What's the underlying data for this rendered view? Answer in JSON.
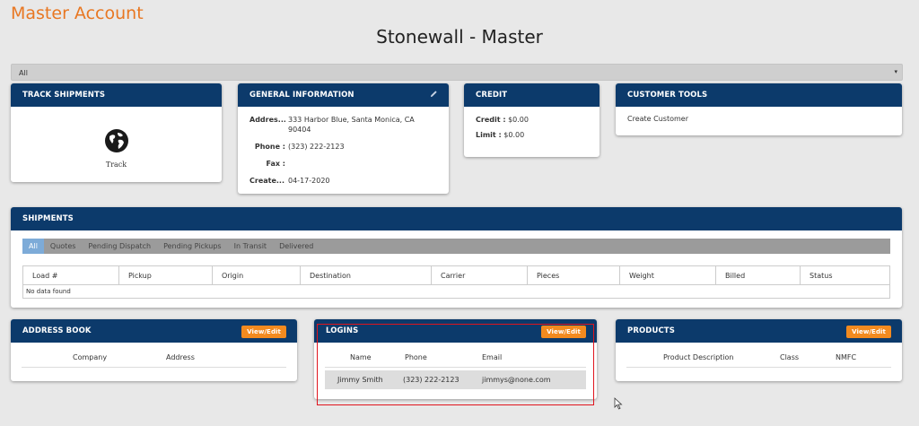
{
  "page": {
    "title": "Master Account",
    "account_name": "Stonewall - Master"
  },
  "filter": {
    "value": "All",
    "caret": "▾"
  },
  "track": {
    "header": "TRACK SHIPMENTS",
    "label": "Track"
  },
  "general": {
    "header": "GENERAL INFORMATION",
    "address_label": "Addres...",
    "address_value": "333 Harbor Blue, Santa Monica, CA 90404",
    "phone_label": "Phone :",
    "phone_value": "(323) 222-2123",
    "fax_label": "Fax :",
    "fax_value": "",
    "created_label": "Create...",
    "created_value": "04-17-2020"
  },
  "credit": {
    "header": "CREDIT",
    "credit_label": "Credit :",
    "credit_value": "$0.00",
    "limit_label": "Limit :",
    "limit_value": "$0.00"
  },
  "tools": {
    "header": "CUSTOMER TOOLS",
    "create_customer": "Create Customer"
  },
  "shipments": {
    "header": "SHIPMENTS",
    "tabs": [
      "All",
      "Quotes",
      "Pending Dispatch",
      "Pending Pickups",
      "In Transit",
      "Delivered"
    ],
    "columns": [
      "Load #",
      "Pickup",
      "Origin",
      "Destination",
      "Carrier",
      "Pieces",
      "Weight",
      "Billed",
      "Status"
    ],
    "empty": "No data found"
  },
  "address_book": {
    "header": "ADDRESS BOOK",
    "button": "View/Edit",
    "columns": [
      "Company",
      "Address"
    ]
  },
  "logins": {
    "header": "LOGINS",
    "button": "View/Edit",
    "columns": [
      "Name",
      "Phone",
      "Email"
    ],
    "rows": [
      {
        "name": "Jimmy Smith",
        "phone": "(323) 222-2123",
        "email": "jimmys@none.com"
      }
    ]
  },
  "products": {
    "header": "PRODUCTS",
    "button": "View/Edit",
    "columns": [
      "Product Description",
      "Class",
      "NMFC"
    ]
  }
}
